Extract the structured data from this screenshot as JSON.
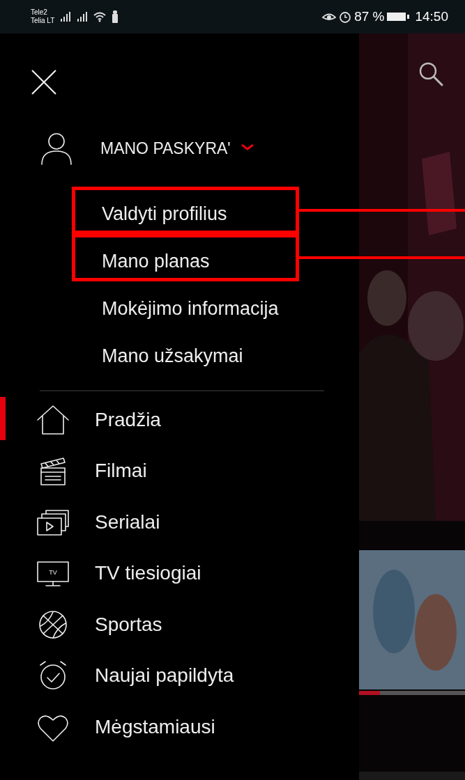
{
  "status_bar": {
    "carriers": [
      "Tele2",
      "Telia LT"
    ],
    "battery": "87 %",
    "time": "14:50"
  },
  "drawer": {
    "account": {
      "label": "MANO PASKYRA'",
      "expanded": true
    },
    "account_items": [
      {
        "label": "Valdyti profilius",
        "highlighted": true
      },
      {
        "label": "Mano planas",
        "highlighted": true
      },
      {
        "label": "Mokėjimo informacija",
        "highlighted": false
      },
      {
        "label": "Mano užsakymai",
        "highlighted": false
      }
    ],
    "nav_items": [
      {
        "kind": "home",
        "label": "Pradžia",
        "selected": true
      },
      {
        "kind": "movies",
        "label": "Filmai",
        "selected": false
      },
      {
        "kind": "series",
        "label": "Serialai",
        "selected": false
      },
      {
        "kind": "tv",
        "label": "TV tiesiogiai",
        "icon_text": "TV",
        "selected": false
      },
      {
        "kind": "sports",
        "label": "Sportas",
        "selected": false
      },
      {
        "kind": "new",
        "label": "Naujai papildyta",
        "selected": false
      },
      {
        "kind": "favorites",
        "label": "Mėgstamiausi",
        "selected": false
      }
    ]
  }
}
